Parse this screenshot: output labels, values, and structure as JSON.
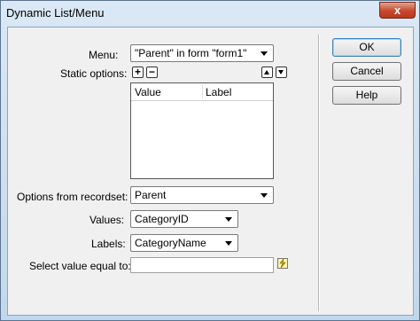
{
  "window": {
    "title": "Dynamic List/Menu",
    "close_glyph": "x"
  },
  "menu": {
    "label": "Menu:",
    "value": "\"Parent\" in form \"form1\""
  },
  "static_options": {
    "label": "Static options:",
    "add_glyph": "+",
    "remove_glyph": "−",
    "columns": [
      "Value",
      "Label"
    ],
    "rows": []
  },
  "recordset": {
    "label": "Options from recordset:",
    "value": "Parent"
  },
  "values": {
    "label": "Values:",
    "value": "CategoryID"
  },
  "labels": {
    "label": "Labels:",
    "value": "CategoryName"
  },
  "select_value": {
    "label": "Select value equal to:",
    "value": ""
  },
  "buttons": {
    "ok": "OK",
    "cancel": "Cancel",
    "help": "Help"
  },
  "icons": {
    "close": "close-icon",
    "add": "plus-icon",
    "remove": "minus-icon",
    "up": "arrow-up-icon",
    "down": "arrow-down-icon",
    "dynamic": "lightning-bolt-icon"
  }
}
